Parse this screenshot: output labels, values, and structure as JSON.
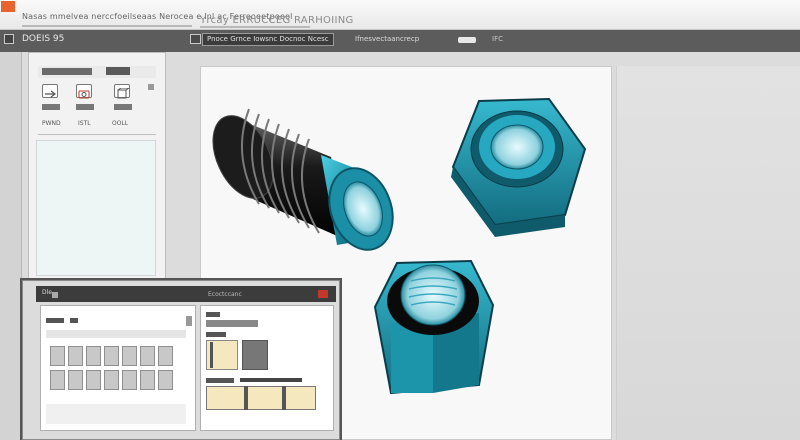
{
  "titlebar": {
    "app_title": "Nasas mmelvea nerccfoeilseaas Nerocea e Inl ac Ferrooeetpoeol",
    "title_right": "Yrcay ERRUCCEG RARHOIING"
  },
  "toolbar": {
    "label": "DOEIS 95",
    "crumb": "Pnoce Grnce Iowsnc Docnoc Ncesc",
    "mid_label": "Ifnesvectaancrecp",
    "right_label": "IFC"
  },
  "left_panel": {
    "tool_labels": [
      "PWND",
      "ISTL",
      "OOLL"
    ]
  },
  "inset": {
    "title": "Dle",
    "label2": "Ecoctccanc"
  },
  "colors": {
    "accent_teal": "#1a8fa6",
    "part_black": "#1a1a1a",
    "titlebar_orange": "#e8632e"
  }
}
